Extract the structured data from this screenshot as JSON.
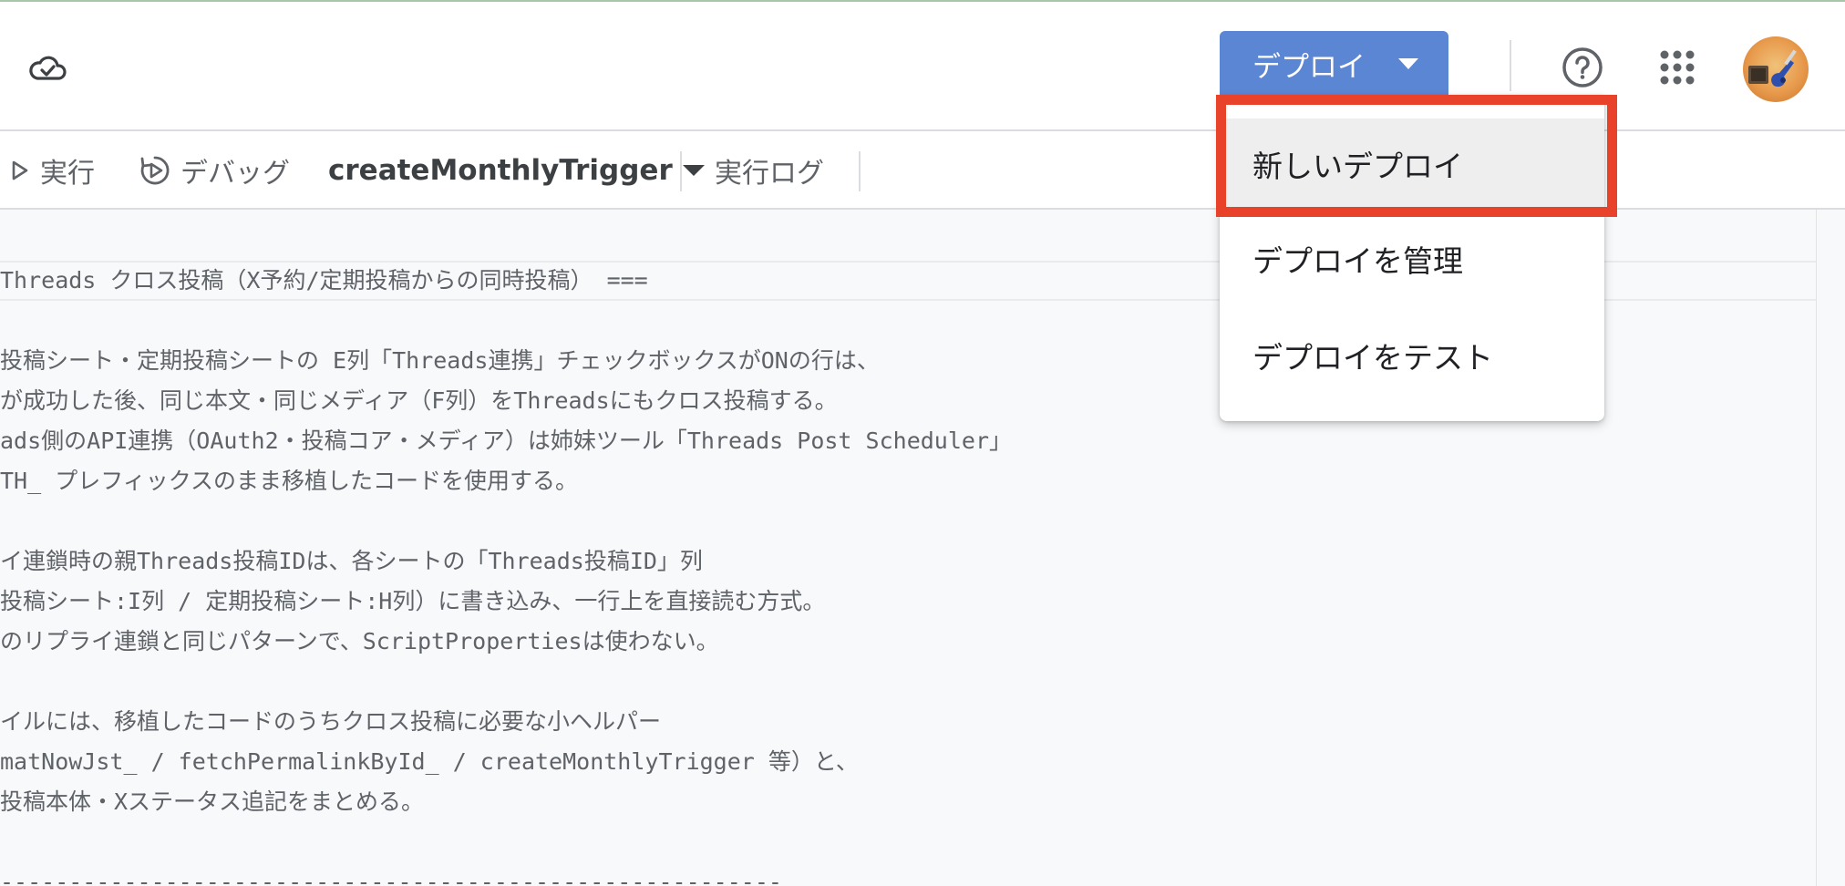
{
  "header": {
    "deploy_button_label": "デプロイ"
  },
  "toolbar": {
    "run_label": "実行",
    "debug_label": "デバッグ",
    "function_select_value": "createMonthlyTrigger",
    "execution_log_label": "実行ログ"
  },
  "deploy_menu": {
    "items": [
      {
        "label": "新しいデプロイ"
      },
      {
        "label": "デプロイを管理"
      },
      {
        "label": "デプロイをテスト"
      }
    ]
  },
  "editor": {
    "lines": [
      "Threads クロス投稿（X予約/定期投稿からの同時投稿） ===",
      "",
      "投稿シート・定期投稿シートの E列「Threads連携」チェックボックスがONの行は、",
      "が成功した後、同じ本文・同じメディア（F列）をThreadsにもクロス投稿する。",
      "ads側のAPI連携（OAuth2・投稿コア・メディア）は姉妹ツール「Threads Post Scheduler」",
      "TH_ プレフィックスのまま移植したコードを使用する。",
      "",
      "イ連鎖時の親Threads投稿IDは、各シートの「Threads投稿ID」列",
      "投稿シート:I列 / 定期投稿シート:H列）に書き込み、一行上を直接読む方式。",
      "のリプライ連鎖と同じパターンで、ScriptPropertiesは使わない。",
      "",
      "イルには、移植したコードのうちクロス投稿に必要な小ヘルパー",
      "matNowJst_ / fetchPermalinkById_ / createMonthlyTrigger 等）と、",
      "投稿本体・Xステータス追記をまとめる。",
      "",
      "---------------------------------------------------------"
    ]
  },
  "colors": {
    "deploy_button": "#5b86d4",
    "highlight_box": "#e8432a",
    "menu_hover": "#eeeeee",
    "editor_background": "#f8f9fa"
  },
  "icons": [
    "cloud-save-icon",
    "help-icon",
    "apps-grid-icon",
    "play-icon",
    "debug-icon",
    "caret-down-icon"
  ]
}
